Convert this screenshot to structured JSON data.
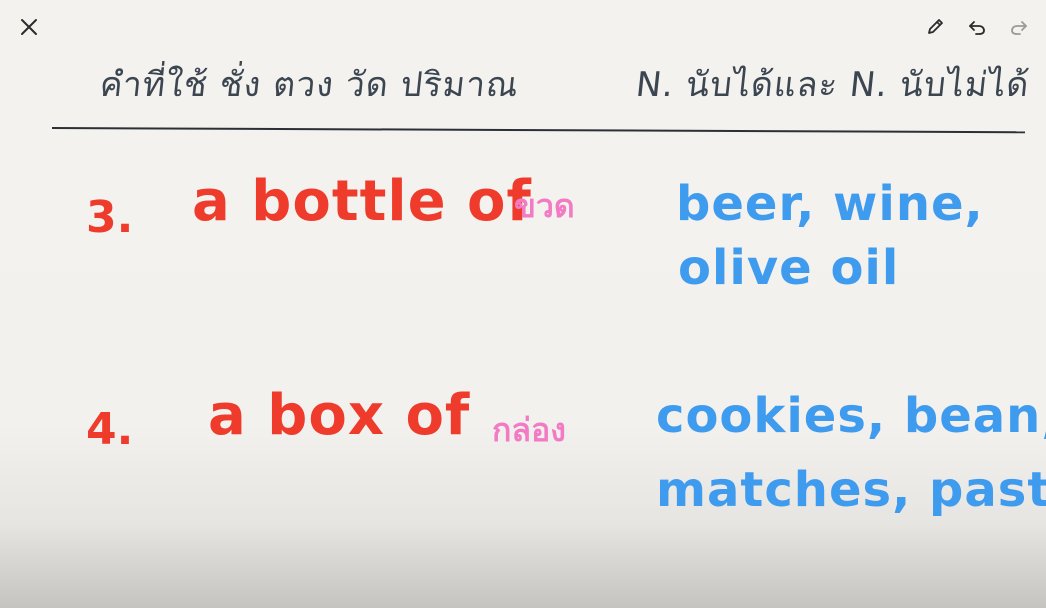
{
  "toolbar": {
    "close_icon": "close-icon",
    "pencil_icon": "pencil-icon",
    "undo_icon": "undo-icon",
    "redo_icon": "redo-icon"
  },
  "header": {
    "left_title": "คำที่ใช้ ชั่ง ตวง วัด ปริมาณ",
    "right_title": "N. นับได้และ N. นับไม่ได้"
  },
  "items": [
    {
      "number": "3.",
      "phrase": "a bottle of",
      "thai": "ขวด",
      "examples_line1": "beer, wine,",
      "examples_line2": "olive oil"
    },
    {
      "number": "4.",
      "phrase": "a box of",
      "thai": "กล่อง",
      "examples_line1": "cookies, bean,",
      "examples_line2": "matches, pasta"
    }
  ],
  "colors": {
    "number_and_phrase": "#ee3b2b",
    "thai_translation": "#f27bc4",
    "examples": "#3f9bee",
    "header": "#3c4650",
    "background": "#f4f2ef"
  }
}
